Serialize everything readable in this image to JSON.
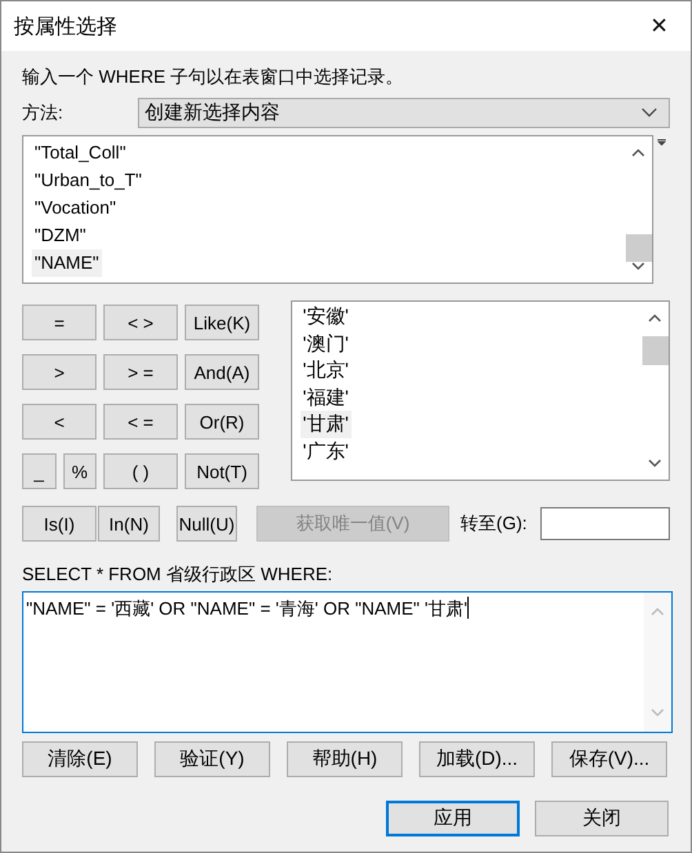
{
  "window": {
    "title": "按属性选择",
    "close": "✕"
  },
  "description": "输入一个 WHERE 子句以在表窗口中选择记录。",
  "method": {
    "label": "方法:",
    "value": "创建新选择内容"
  },
  "fields": [
    {
      "text": "\"Total_Coll\"",
      "selected": false
    },
    {
      "text": "\"Urban_to_T\"",
      "selected": false
    },
    {
      "text": "\"Vocation\"",
      "selected": false
    },
    {
      "text": "\"DZM\"",
      "selected": false
    },
    {
      "text": "\"NAME\"",
      "selected": true
    }
  ],
  "operators": [
    {
      "label": "=",
      "kind": "wide"
    },
    {
      "label": "< >",
      "kind": "wide"
    },
    {
      "label": "Like(K)",
      "kind": "wide"
    },
    {
      "label": ">",
      "kind": "wide"
    },
    {
      "label": "> =",
      "kind": "wide"
    },
    {
      "label": "And(A)",
      "kind": "wide"
    },
    {
      "label": "<",
      "kind": "wide"
    },
    {
      "label": "< =",
      "kind": "wide"
    },
    {
      "label": "Or(R)",
      "kind": "wide"
    },
    {
      "label": "_",
      "kind": "half"
    },
    {
      "label": "%",
      "kind": "half"
    },
    {
      "label": "( )",
      "kind": "wide"
    },
    {
      "label": "Not(T)",
      "kind": "wide"
    }
  ],
  "values": [
    {
      "text": "'安徽'",
      "selected": false
    },
    {
      "text": "'澳门'",
      "selected": false
    },
    {
      "text": "'北京'",
      "selected": false
    },
    {
      "text": "'福建'",
      "selected": false
    },
    {
      "text": "'甘肃'",
      "selected": true
    },
    {
      "text": "'广东'",
      "selected": false
    }
  ],
  "row_buttons": [
    {
      "label": "Is(I)",
      "disabled": false
    },
    {
      "label": "In(N)",
      "disabled": false
    },
    {
      "label": "Null(U)",
      "disabled": false
    },
    {
      "label": "获取唯一值(V)",
      "disabled": true
    }
  ],
  "goto": {
    "label": "转至(G):"
  },
  "sql_label": "SELECT * FROM 省级行政区 WHERE:",
  "expression": "\"NAME\" = '西藏' OR \"NAME\" = '青海' OR \"NAME\" '甘肃'",
  "actions": [
    "清除(E)",
    "验证(Y)",
    "帮助(H)",
    "加载(D)...",
    "保存(V)..."
  ],
  "footer": [
    {
      "label": "应用",
      "focused": true
    },
    {
      "label": "关闭",
      "focused": false
    }
  ]
}
